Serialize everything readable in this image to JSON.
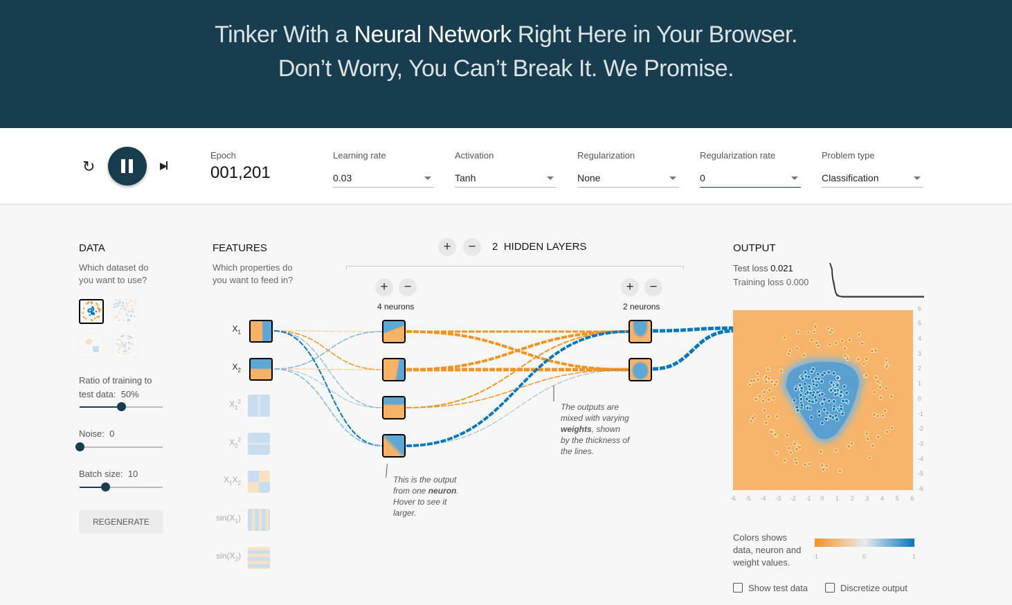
{
  "header": {
    "line1_pre": "Tinker With a ",
    "line1_bold": "Neural Network",
    "line1_post": " Right Here in Your Browser.",
    "line2": "Don’t Worry, You Can’t Break It. We Promise."
  },
  "controls": {
    "epoch_label": "Epoch",
    "epoch": "001,201",
    "learning_rate": {
      "label": "Learning rate",
      "value": "0.03"
    },
    "activation": {
      "label": "Activation",
      "value": "Tanh"
    },
    "regularization": {
      "label": "Regularization",
      "value": "None"
    },
    "regularization_rate": {
      "label": "Regularization rate",
      "value": "0"
    },
    "problem_type": {
      "label": "Problem type",
      "value": "Classification"
    },
    "play_state": "playing"
  },
  "data": {
    "title": "DATA",
    "question": "Which dataset do you want to use?",
    "datasets": [
      "circle",
      "xor",
      "gaussian",
      "spiral"
    ],
    "selected": "circle",
    "ratio_label": "Ratio of training to test data:",
    "ratio_value": "50%",
    "ratio": 50,
    "noise_label": "Noise:",
    "noise_value": "0",
    "noise": 0,
    "batch_label": "Batch size:",
    "batch_value": "10",
    "batch": 10,
    "regenerate": "REGENERATE"
  },
  "features": {
    "title": "FEATURES",
    "question": "Which properties do you want to feed in?",
    "items": [
      {
        "label": "X",
        "sub": "1",
        "sup": "",
        "active": true
      },
      {
        "label": "X",
        "sub": "2",
        "sup": "",
        "active": true
      },
      {
        "label": "X",
        "sub": "1",
        "sup": "2",
        "active": false
      },
      {
        "label": "X",
        "sub": "2",
        "sup": "2",
        "active": false
      },
      {
        "label": "X",
        "sub": "1",
        "sup": "",
        "label2": "X",
        "sub2": "2",
        "active": false
      },
      {
        "label": "sin(X",
        "sub": "1",
        "sup": "",
        "suffix": ")",
        "active": false
      },
      {
        "label": "sin(X",
        "sub": "2",
        "sup": "",
        "suffix": ")",
        "active": false
      }
    ]
  },
  "network": {
    "hidden_layers_count": "2",
    "hidden_layers_label": "HIDDEN LAYERS",
    "layers": [
      {
        "neurons_label": "4 neurons"
      },
      {
        "neurons_label": "2 neurons"
      }
    ],
    "note1": {
      "pre": "This is the output from one ",
      "bold": "neuron",
      "post": ". Hover to see it larger."
    },
    "note2": {
      "pre": "The outputs are mixed with varying ",
      "bold": "weights",
      "post": ", shown by the thickness of the lines."
    }
  },
  "output": {
    "title": "OUTPUT",
    "test_loss_label": "Test loss",
    "test_loss": "0.021",
    "train_loss_label": "Training loss",
    "train_loss": "0.000",
    "axis_ticks": [
      "-6",
      "-5",
      "-4",
      "-3",
      "-2",
      "-1",
      "0",
      "1",
      "2",
      "3",
      "4",
      "5",
      "6"
    ],
    "legend_text": "Colors shows data, neuron and weight values.",
    "legend_ticks": [
      "-1",
      "0",
      "1"
    ],
    "show_test_data": "Show test data",
    "discretize": "Discretize output"
  },
  "colors": {
    "orange": "#f59322",
    "blue": "#0877bd",
    "dark": "#183d4e"
  }
}
